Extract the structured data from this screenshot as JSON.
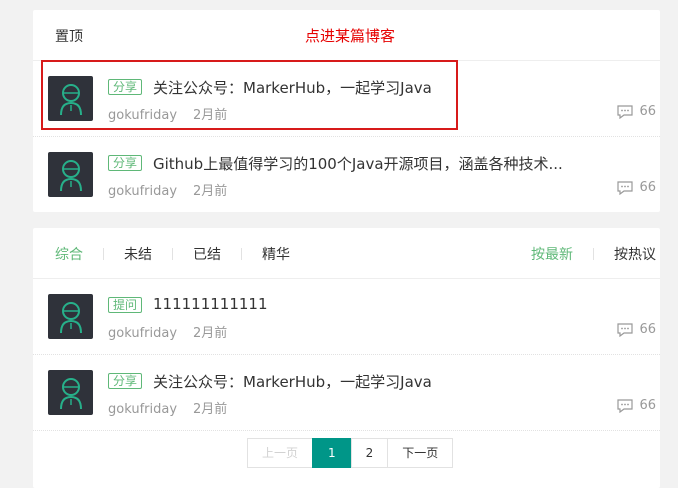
{
  "top_section": {
    "title": "置顶",
    "annotation": "点进某篇博客",
    "posts": [
      {
        "badge": "分享",
        "title": "关注公众号：MarkerHub，一起学习Java",
        "author": "gokufriday",
        "time": "2月前",
        "comments": "66"
      },
      {
        "badge": "分享",
        "title": "Github上最值得学习的100个Java开源项目，涵盖各种技术...",
        "author": "gokufriday",
        "time": "2月前",
        "comments": "66"
      }
    ]
  },
  "list_section": {
    "tabs": [
      "综合",
      "未结",
      "已结",
      "精华"
    ],
    "sorts": [
      "按最新",
      "按热议"
    ],
    "posts": [
      {
        "badge": "提问",
        "title": "111111111111",
        "author": "gokufriday",
        "time": "2月前",
        "comments": "66"
      },
      {
        "badge": "分享",
        "title": "关注公众号：MarkerHub，一起学习Java",
        "author": "gokufriday",
        "time": "2月前",
        "comments": "66"
      }
    ]
  },
  "pagination": {
    "prev": "上一页",
    "pages": [
      "1",
      "2"
    ],
    "next": "下一页"
  },
  "colors": {
    "accent": "#5fb878",
    "pager_active": "#009688",
    "highlight": "#d71a1a"
  }
}
